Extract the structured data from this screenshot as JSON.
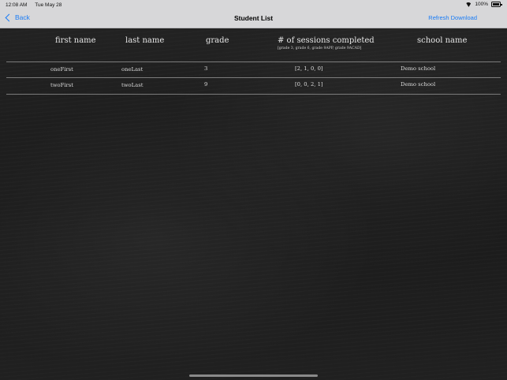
{
  "status_bar": {
    "time": "12:08 AM",
    "date": "Tue May 28",
    "battery": "100%"
  },
  "nav": {
    "back_label": "Back",
    "title": "Student List",
    "refresh_label": "Refresh Download"
  },
  "table": {
    "headers": {
      "first_name": "first name",
      "last_name": "last name",
      "grade": "grade",
      "sessions": "# of sessions completed",
      "sessions_sub": "[grade 3, grade 6, grade 9APP, grade 9ACAD]",
      "school": "school name"
    },
    "rows": [
      {
        "first_name": "oneFirst",
        "last_name": "oneLast",
        "grade": "3",
        "sessions": "[2, 1, 0, 0]",
        "school": "Demo school"
      },
      {
        "first_name": "twoFirst",
        "last_name": "twoLast",
        "grade": "9",
        "sessions": "[0, 0, 2, 1]",
        "school": "Demo school"
      }
    ]
  },
  "colors": {
    "accent": "#1a7cf6",
    "bar_bg": "#d7d7d9",
    "board": "#1d1d1d",
    "chalk": "#e6e6e6"
  }
}
